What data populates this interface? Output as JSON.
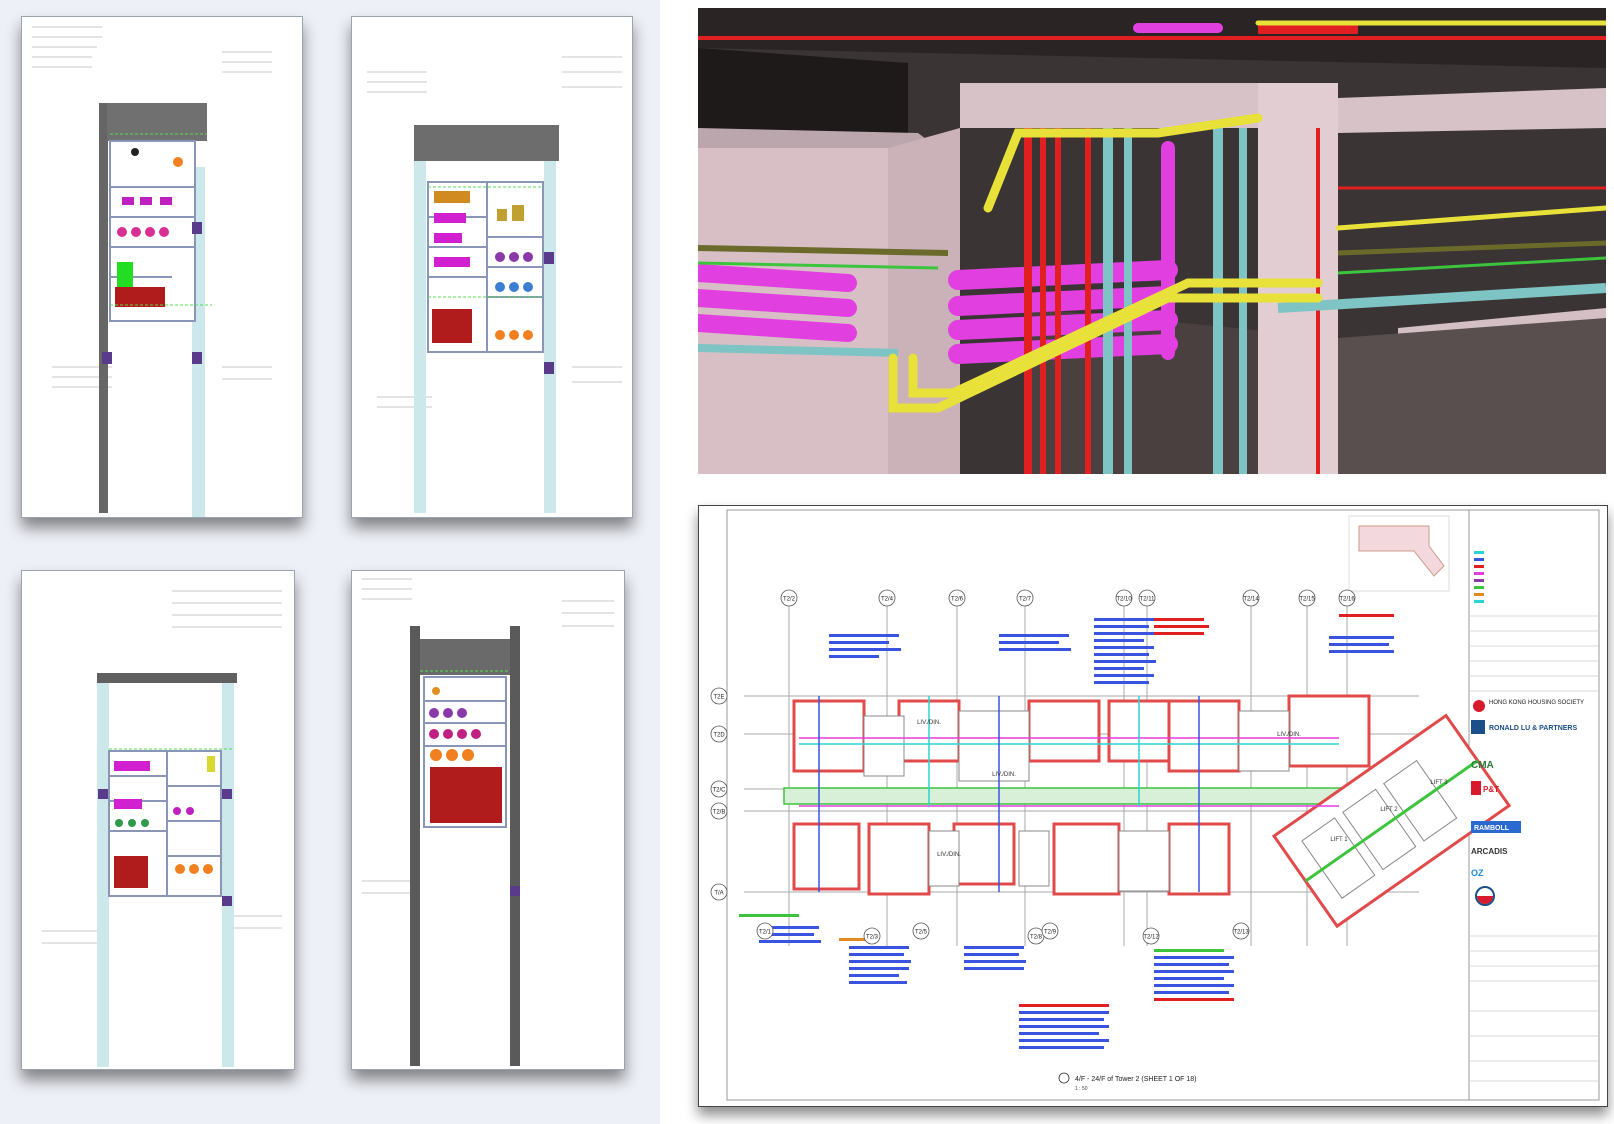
{
  "gridlines_top": [
    "T2/2",
    "T2/4",
    "T2/6",
    "T2/7",
    "T2/10",
    "T2/11",
    "T2/14",
    "T2/15",
    "T2/16"
  ],
  "gridlines_bottom": [
    "T2/1",
    "T2/3",
    "T2/5",
    "T2/8",
    "T2/9",
    "T2/12",
    "T2/13"
  ],
  "gridlines_left": [
    "T2E",
    "T2D",
    "T2/C",
    "T2/B",
    "T/A"
  ],
  "room_labels": [
    "LIV./DIN.",
    "LIV./DIN.",
    "LIV./DIN.",
    "LIV./DIN.",
    "LIFT 1",
    "LIFT 2",
    "LIFT 3"
  ],
  "title_block": {
    "consultants": [
      "HONG KONG HOUSING SOCIETY",
      "RONALD LU & PARTNERS",
      "CMA",
      "P&T",
      "RAMBOLL",
      "ARCADIS",
      "OZ"
    ],
    "drawing_title": "4/F - 24/F of Tower 2 (SHEET 1 OF 18)",
    "scale": "1 : 50"
  },
  "colors": {
    "magenta_pipe": "#e23fe0",
    "red_pipe": "#e02020",
    "yellow_pipe": "#e8e13a",
    "teal_duct": "#7ec4c4",
    "green_pipe": "#3dc43d",
    "concrete": "#d8c3c8"
  }
}
